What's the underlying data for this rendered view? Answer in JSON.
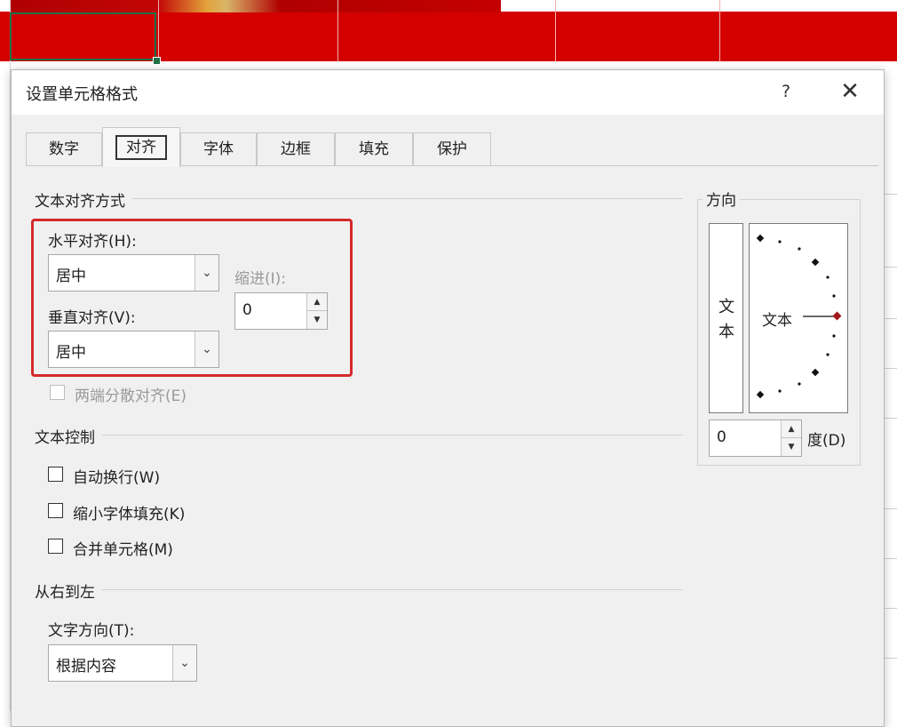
{
  "dialog": {
    "title": "设置单元格格式",
    "help": "?",
    "close": "✕",
    "tabs": [
      {
        "label": "数字"
      },
      {
        "label": "对齐"
      },
      {
        "label": "字体"
      },
      {
        "label": "边框"
      },
      {
        "label": "填充"
      },
      {
        "label": "保护"
      }
    ],
    "active_tab": "对齐"
  },
  "text_alignment": {
    "section": "文本对齐方式",
    "horizontal_label": "水平对齐(H):",
    "horizontal_value": "居中",
    "vertical_label": "垂直对齐(V):",
    "vertical_value": "居中",
    "indent_label": "缩进(I):",
    "indent_value": "0",
    "justify_distributed": "两端分散对齐(E)"
  },
  "text_control": {
    "section": "文本控制",
    "wrap_text": "自动换行(W)",
    "shrink_to_fit": "缩小字体填充(K)",
    "merge_cells": "合并单元格(M)"
  },
  "right_to_left": {
    "section": "从右到左",
    "direction_label": "文字方向(T):",
    "direction_value": "根据内容"
  },
  "orientation": {
    "section": "方向",
    "vertical_text": "文本",
    "dial_text": "文本",
    "degrees_value": "0",
    "degrees_label": "度(D)"
  },
  "colors": {
    "sheet_band": "#d40000",
    "highlight": "#d52a2a",
    "selection": "#1e7145",
    "dial_marker": "#a01818"
  }
}
